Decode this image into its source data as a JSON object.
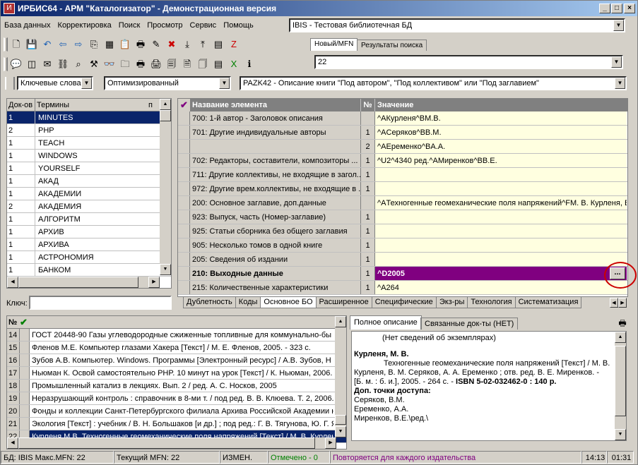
{
  "window": {
    "title": "ИРБИС64 - АРМ \"Каталогизатор\" - Демонстрационная версия",
    "app_icon": "irbis-app-icon",
    "controls": [
      "_",
      "□",
      "×"
    ]
  },
  "menu": [
    "База данных",
    "Корректировка",
    "Поиск",
    "Просмотр",
    "Сервис",
    "Помощь"
  ],
  "db_select": {
    "value": "IBIS - Тестовая библиотечная БД"
  },
  "right_tabs": [
    "Новый/MFN",
    "Результаты поиска"
  ],
  "mfn_field": {
    "value": "22"
  },
  "toolbar1_icons": [
    "new-doc-icon",
    "save-icon",
    "undo-icon",
    "back-icon",
    "forward-icon",
    "copy-icon",
    "grid-icon",
    "paste-icon",
    "print-icon",
    "edit-icon",
    "delete-icon",
    "import-icon",
    "export-icon",
    "dict-icon",
    "z3950-icon"
  ],
  "toolbar2_icons": [
    "chat-icon",
    "view-icon",
    "mail-icon",
    "link-icon",
    "search-icon",
    "tools-icon",
    "glasses-icon",
    "folders-icon",
    "printer-icon",
    "print2-icon",
    "docs-icon",
    "doc2-icon",
    "doc3-icon",
    "sheet-icon",
    "excel-icon",
    "info-icon"
  ],
  "search_mode": {
    "value": "Ключевые слова"
  },
  "search_opt": {
    "value": "Оптимизированный"
  },
  "worksheet": {
    "value": "PAZK42 - Описание книги \"Под автором\", \"Под коллективом\" или \"Под заглавием\""
  },
  "terms": {
    "col_docs": "Док-ов",
    "col_terms": "Термины",
    "pin": "п",
    "key_label": "Ключ:",
    "rows": [
      [
        "1",
        "MINUTES"
      ],
      [
        "2",
        "PHP"
      ],
      [
        "1",
        "TEACH"
      ],
      [
        "1",
        "WINDOWS"
      ],
      [
        "1",
        "YOURSELF"
      ],
      [
        "1",
        "АКАД"
      ],
      [
        "1",
        "АКАДЕМИИ"
      ],
      [
        "2",
        "АКАДЕМИЯ"
      ],
      [
        "1",
        "АЛГОРИТМ"
      ],
      [
        "1",
        "АРХИВ"
      ],
      [
        "1",
        "АРХИВА"
      ],
      [
        "1",
        "АСТРОНОМИЯ"
      ],
      [
        "1",
        "БАНКОМ"
      ]
    ]
  },
  "editor": {
    "col_name": "Название элемента",
    "col_no": "№",
    "col_value": "Значение",
    "rows": [
      [
        "700: 1-й автор - Заголовок описания",
        "",
        "^AКурленя^BМ.В."
      ],
      [
        "701: Другие индивидуальные авторы",
        "1",
        "^AСеряков^BВ.М."
      ],
      [
        "",
        "2",
        "^AЕременко^BА.А."
      ],
      [
        "702: Редакторы, составители, композиторы ...",
        "1",
        "^U2^4340 ред.^AМиренков^BВ.Е."
      ],
      [
        "711: Другие коллективы, не входящие в загол...",
        "1",
        ""
      ],
      [
        "972: Другие врем.коллективы, не входящие в ...",
        "1",
        ""
      ],
      [
        "200: Основное заглавие, доп.данные",
        "",
        "^AТехногенные геомеханические поля напряжений^FМ. В. Курленя, В"
      ],
      [
        "923: Выпуск, часть (Номер-заглавие)",
        "1",
        ""
      ],
      [
        "925: Статьи сборника без общего заглавия",
        "1",
        ""
      ],
      [
        "905: Несколько томов в одной книге",
        "1",
        ""
      ],
      [
        "205: Сведения об издании",
        "1",
        ""
      ],
      [
        "210: Выходные данные",
        "1",
        "^D2005"
      ],
      [
        "215: Количественные характеристики",
        "1",
        "^A264"
      ]
    ],
    "ellipsis": "...",
    "tabs": [
      "Дублетность",
      "Коды",
      "Основное БО",
      "Расширенное",
      "Специфические",
      "Экз-ры",
      "Технология",
      "Систематизация"
    ]
  },
  "results": {
    "col_no": "№",
    "rows": [
      [
        "14",
        "ГОСТ 20448-90 Газы углеводородные сжиженные топливные для коммунально-бы"
      ],
      [
        "15",
        "Фленов М.Е. Компьютер глазами Хакера [Текст] / М. Е. Фленов, 2005. - 323 с."
      ],
      [
        "16",
        "Зубов А.В. Компьютер. Windows. Программы [Электронный ресурс] / А.В. Зубов, Н"
      ],
      [
        "17",
        "Ньюман К. Освой самостоятельно PHP. 10 минут на урок [Текст] / К. Ньюман, 2006."
      ],
      [
        "18",
        "Промышленный катализ в лекциях. Вып. 2 / ред. А. С. Носков, 2005"
      ],
      [
        "19",
        "Неразрушающий контроль : справочник в 8-ми т. / под ред. В. В. Клюева. Т. 2, 2006."
      ],
      [
        "20",
        "Фонды и коллекции Санкт-Петербургского филиала Архива Российской Академии н"
      ],
      [
        "21",
        "Экология [Текст] : учебник / В. Н. Большаков [и др.] ; под ред.: Г. В. Тягунова, Ю. Г. Я"
      ],
      [
        "22",
        "Курленя М.В. Техногенные геомеханические поля напряжений [Текст] / М. В. Курлен"
      ]
    ]
  },
  "desc": {
    "tabs": [
      "Полное описание",
      "Связанные док-ты (НЕТ)"
    ],
    "no_copies": "(Нет сведений об экземплярах)",
    "author": "Курленя, М. В.",
    "body": "Техногенные геомеханические поля напряжений [Текст] / М. В. Курленя, В. М. Серяков, А. А. Еременко ; отв. ред. В. Е. Миренков. - [Б. м. : б. и.], 2005. - 264 с. -",
    "isbn": "ISBN 5-02-032462-0 : 140 р.",
    "access_label": "Доп. точки доступа:",
    "access": [
      "Серяков, В.М.",
      "Еременко, А.А.",
      "Миренков, В.Е.\\ред.\\"
    ]
  },
  "status": {
    "db": "БД: IBIS Макс.MFN: 22",
    "current": "Текущий MFN: 22",
    "changed": "ИЗМЕН.",
    "marked": "Отмечено - 0",
    "hint": "Повторяется для каждого издательства",
    "time": "14:13",
    "clock": "01:31"
  },
  "colors": {
    "selected": "#0a246a",
    "highlight": "#800080",
    "accent_red": "#cc0000",
    "green": "#008000"
  }
}
